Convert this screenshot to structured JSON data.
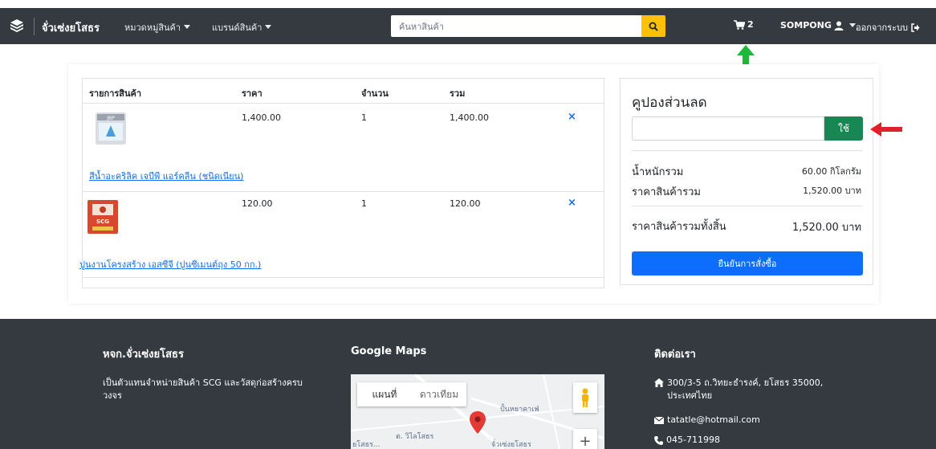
{
  "header": {
    "brand": "จั่วเซ่งยโสธร",
    "nav_categories": "หมวดหมู่สินค้า",
    "nav_brands": "แบรนด์สินค้า",
    "search_placeholder": "ค้นหาสินค้า",
    "cart_count": "2",
    "username": "SOMPONG",
    "logout": "ออกจากระบบ"
  },
  "cart": {
    "columns": [
      "รายการสินค้า",
      "ราคา",
      "จำนวน",
      "รวม"
    ],
    "items": [
      {
        "name": "สีน้ำอะคริลิค เจบีพี แอร์คลีน (ชนิดเนียน)",
        "price": "1,400.00",
        "qty": "1",
        "total": "1,400.00",
        "thumb_label": "JBP"
      },
      {
        "name": "ปูนงานโครงสร้าง เอสซีจี (ปูนซีเมนต์ถุง 50 กก.)",
        "price": "120.00",
        "qty": "1",
        "total": "120.00",
        "thumb_label": "SCG"
      }
    ],
    "remove_symbol": "×"
  },
  "summary": {
    "title": "คูปองส่วนลด",
    "coupon_value": "",
    "apply_label": "ใช้",
    "weight_label": "น้ำหนักรวม",
    "weight_value": "60.00 กิโลกรัม",
    "subtotal_label": "ราคาสินค้ารวม",
    "subtotal_value": "1,520.00 บาท",
    "total_label": "ราคาสินค้ารวมทั้งสิ้น",
    "total_value": "1,520.00 บาท",
    "confirm_label": "ยืนยันการสั่งซื้อ"
  },
  "footer": {
    "about_title": "หจก.จั่วเซ่งยโสธร",
    "about_text": "เป็นตัวแทนจำหน่ายสินค้า SCG และวัสดุก่อสร้างครบวงจร",
    "maps_title": "Google Maps",
    "map_tab_map": "แผนที่",
    "map_tab_satellite": "ดาวเทียม",
    "map_label_1": "ปั้นหยาคาเฟ่",
    "map_label_2": "ต. วิไลโสธร",
    "map_label_3": "จั่วเซ่งยโสธร",
    "map_label_4": "ยโสธร...",
    "contact_title": "ติดต่อเรา",
    "address": "300/3-5 ถ.วิทยะธำรงค์, ยโสธร 35000, ประเทศไทย",
    "email": "tatatle@hotmail.com",
    "phone": "045-711998"
  },
  "colors": {
    "navbar": "#343a40",
    "search_button": "#ffc107",
    "apply_button": "#198754",
    "confirm_button": "#0d6efd",
    "annotation_green": "#1fb83a",
    "annotation_red": "#e0202a"
  },
  "icons": [
    "logo-icon",
    "search-icon",
    "cart-icon",
    "user-icon",
    "logout-icon",
    "home-icon",
    "envelope-icon",
    "phone-icon",
    "pegman-icon",
    "map-pin-icon"
  ]
}
